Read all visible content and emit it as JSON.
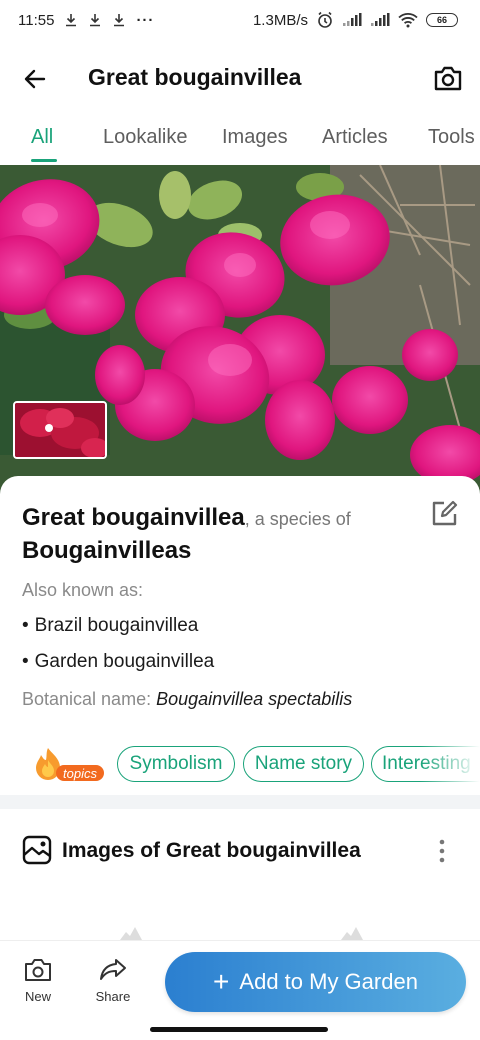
{
  "status_bar": {
    "time": "11:55",
    "more": "···",
    "network_speed": "1.3MB/s",
    "battery": "66"
  },
  "header": {
    "title": "Great bougainvillea"
  },
  "tabs": [
    {
      "label": "All",
      "active": true
    },
    {
      "label": "Lookalike"
    },
    {
      "label": "Images"
    },
    {
      "label": "Articles"
    },
    {
      "label": "Tools"
    }
  ],
  "species": {
    "common_name": "Great bougainvillea",
    "species_of_text": ", a species of",
    "genus": "Bougainvilleas",
    "also_known_label": "Also known as:",
    "also_known": [
      "Brazil bougainvillea",
      "Garden bougainvillea"
    ],
    "botanical_label": "Botanical name:",
    "botanical_name": "Bougainvillea spectabilis"
  },
  "topics": {
    "badge_label": "topics",
    "chips": [
      "Symbolism",
      "Name story",
      "Interesting"
    ]
  },
  "images_section": {
    "title": "Images of Great bougainvillea"
  },
  "bottom_bar": {
    "new_label": "New",
    "share_label": "Share",
    "add_plus": "+",
    "add_label": "Add to My Garden"
  },
  "colors": {
    "accent": "#1aa37a",
    "primary_button_start": "#2b7fd0",
    "primary_button_end": "#5aaee0",
    "flower": "#e0167f",
    "topics_badge": "#f26a1f"
  },
  "icons": {
    "back": "arrow-left-icon",
    "camera": "camera-icon",
    "edit": "edit-icon",
    "gallery": "gallery-icon",
    "more": "more-vertical-icon",
    "new": "camera-icon",
    "share": "share-icon"
  }
}
